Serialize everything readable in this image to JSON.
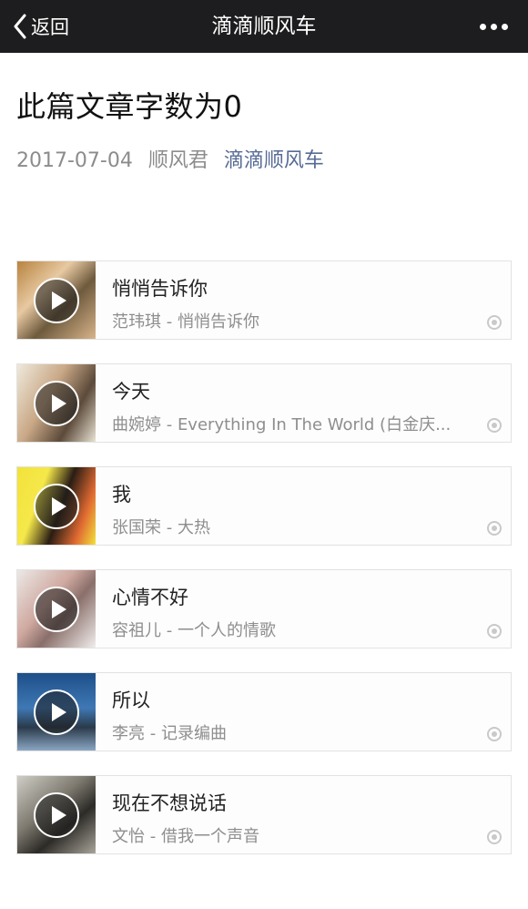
{
  "navbar": {
    "back_label": "返回",
    "title": "滴滴顺风车",
    "more_icon": "more-dots-icon"
  },
  "article": {
    "title": "此篇文章字数为0",
    "date": "2017-07-04",
    "author": "顺风君",
    "account": "滴滴顺风车"
  },
  "colors": {
    "navbar_bg": "#1d1d1f",
    "link": "#576b95",
    "subtext": "#8e8e8e"
  },
  "songs": [
    {
      "title": "悄悄告诉你",
      "subtitle": "范玮琪 - 悄悄告诉你"
    },
    {
      "title": "今天",
      "subtitle": "曲婉婷 - Everything In The World (白金庆..."
    },
    {
      "title": "我",
      "subtitle": "张国荣 - 大热"
    },
    {
      "title": "心情不好",
      "subtitle": "容祖儿 - 一个人的情歌"
    },
    {
      "title": "所以",
      "subtitle": "李亮 - 记录编曲"
    },
    {
      "title": "现在不想说话",
      "subtitle": "文怡 - 借我一个声音"
    }
  ]
}
